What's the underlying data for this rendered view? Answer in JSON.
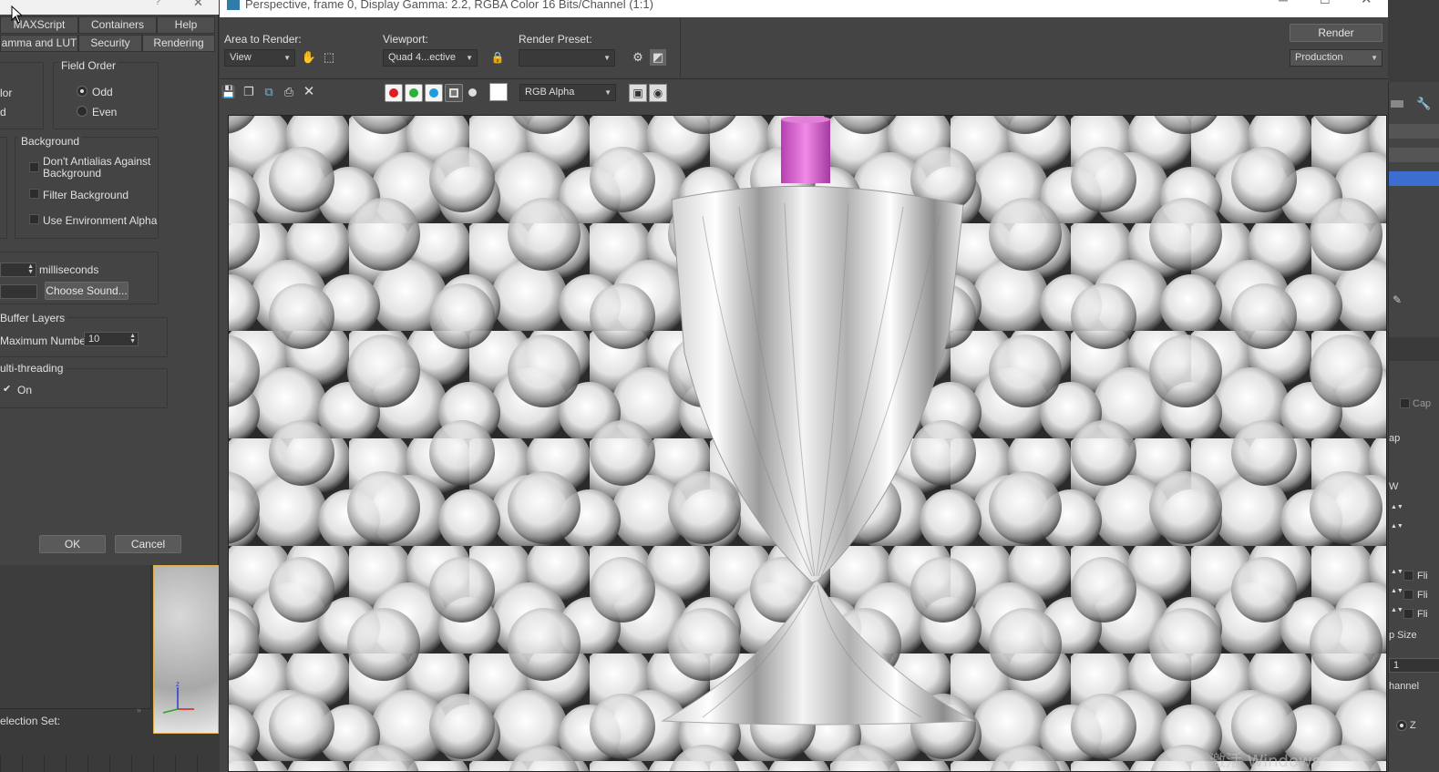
{
  "prefs": {
    "tabs_row1": [
      "MAXScript",
      "Containers",
      "Help"
    ],
    "tabs_row2": [
      "amma and LUT",
      "Security",
      "Rendering"
    ],
    "field_order": {
      "title": "Field Order",
      "partial_left_1": "lor",
      "partial_left_2": "d",
      "odd": "Odd",
      "even": "Even"
    },
    "background": {
      "title": "Background",
      "dont_antialias": "Don't Antialias Against Background",
      "filter_background": "Filter Background",
      "use_env_alpha": "Use Environment Alpha"
    },
    "sound": {
      "unit": "milliseconds",
      "choose_sound": "Choose Sound..."
    },
    "buffer_layers": {
      "title": "Buffer Layers",
      "max_label": "Maximum Number:",
      "max_value": "10"
    },
    "multithreading": {
      "title": "ulti-threading",
      "on_label": "On"
    },
    "ok": "OK",
    "cancel": "Cancel"
  },
  "lower_left": {
    "selection_set_label": "election Set:"
  },
  "render_frame": {
    "title": "Perspective, frame 0, Display Gamma: 2.2, RGBA Color 16 Bits/Channel (1:1)",
    "area_to_render_label": "Area to Render:",
    "area_to_render_value": "View",
    "viewport_label": "Viewport:",
    "viewport_value": "Quad 4...ective",
    "render_preset_label": "Render Preset:",
    "render_preset_value": "",
    "render_button": "Render",
    "production_value": "Production",
    "channel_value": "RGB Alpha",
    "colors": {
      "red": "#e02020",
      "green": "#27b33a",
      "blue": "#1e9be0",
      "swatch": "#ffffff"
    },
    "watermark": "激活 Windows"
  },
  "right_panel": {
    "cap": "Cap",
    "ap": "ap",
    "w": "W",
    "flip": "Fli",
    "p_size": "p Size",
    "spinner_value": "1",
    "channel": "hannel",
    "z_label": "Z"
  }
}
